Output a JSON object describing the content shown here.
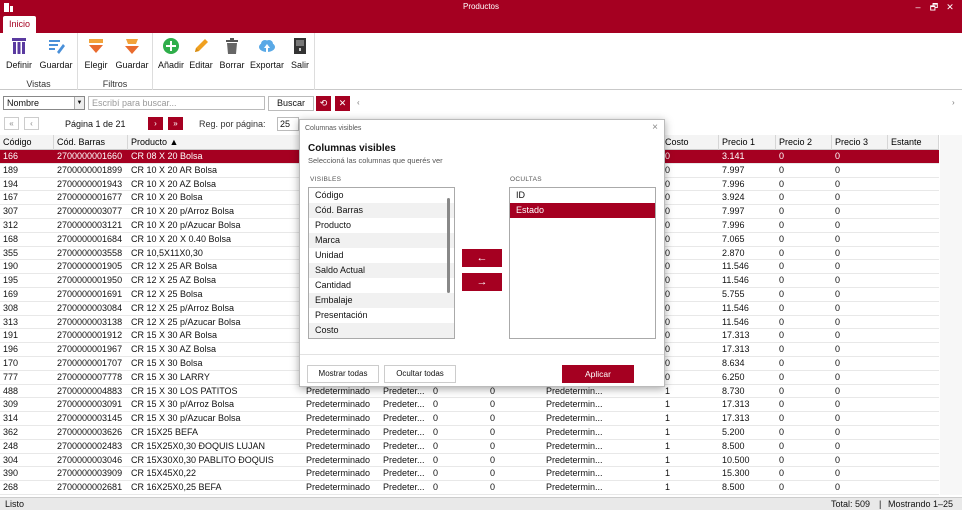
{
  "window": {
    "title": "Productos",
    "controls": {
      "minimize": "–",
      "maximize": "🗗",
      "close": "✕"
    }
  },
  "ribbon": {
    "tab": "Inicio",
    "groups": [
      {
        "label": "Vistas",
        "buttons": [
          {
            "label": "Definir",
            "icon": "columns-icon"
          },
          {
            "label": "Guardar",
            "icon": "save-view-icon"
          }
        ]
      },
      {
        "label": "Filtros",
        "buttons": [
          {
            "label": "Elegir",
            "icon": "filter-icon"
          },
          {
            "label": "Guardar",
            "icon": "save-filter-icon"
          }
        ]
      },
      {
        "label": "",
        "buttons": [
          {
            "label": "Añadir",
            "icon": "add-icon"
          },
          {
            "label": "Editar",
            "icon": "pencil-icon"
          },
          {
            "label": "Borrar",
            "icon": "trash-icon"
          },
          {
            "label": "Exportar",
            "icon": "cloud-upload-icon"
          },
          {
            "label": "Salir",
            "icon": "exit-icon"
          }
        ]
      }
    ]
  },
  "search": {
    "field": "Nombre",
    "placeholder": "Escribí para buscar...",
    "button": "Buscar"
  },
  "pager": {
    "first": "«",
    "prev": "‹",
    "page_text": "Página 1 de 21",
    "next": "›",
    "last": "»",
    "per_page_label": "Reg. por página:",
    "per_page": "25"
  },
  "grid": {
    "columns": [
      "Código",
      "Cód. Barras",
      "Producto ▲",
      "",
      "",
      "",
      "",
      "",
      "Costo",
      "Precio 1",
      "Precio 2",
      "Precio 3",
      "Estante"
    ],
    "rows": [
      {
        "c": [
          "166",
          "2700000001660",
          "CR 08 X 20 Bolsa",
          "",
          "",
          "",
          "",
          "",
          "0",
          "3.141",
          "0",
          "0",
          ""
        ],
        "sel": true
      },
      {
        "c": [
          "189",
          "2700000001899",
          "CR 10 X 20 AR Bolsa",
          "",
          "",
          "",
          "",
          "",
          "0",
          "7.997",
          "0",
          "0",
          ""
        ]
      },
      {
        "c": [
          "194",
          "2700000001943",
          "CR 10 X 20 AZ Bolsa",
          "",
          "",
          "",
          "",
          "",
          "0",
          "7.996",
          "0",
          "0",
          ""
        ]
      },
      {
        "c": [
          "167",
          "2700000001677",
          "CR 10 X 20 Bolsa",
          "",
          "",
          "",
          "",
          "",
          "0",
          "3.924",
          "0",
          "0",
          ""
        ]
      },
      {
        "c": [
          "307",
          "2700000003077",
          "CR 10 X 20 p/Arroz Bolsa",
          "",
          "",
          "",
          "",
          "",
          "0",
          "7.997",
          "0",
          "0",
          ""
        ]
      },
      {
        "c": [
          "312",
          "2700000003121",
          "CR 10 X 20 p/Azucar Bolsa",
          "",
          "",
          "",
          "",
          "",
          "0",
          "7.996",
          "0",
          "0",
          ""
        ]
      },
      {
        "c": [
          "168",
          "2700000001684",
          "CR 10 X 20 X 0.40 Bolsa",
          "",
          "",
          "",
          "",
          "",
          "0",
          "7.065",
          "0",
          "0",
          ""
        ]
      },
      {
        "c": [
          "355",
          "2700000003558",
          "CR 10,5X11X0,30",
          "",
          "",
          "",
          "",
          "",
          "0",
          "2.870",
          "0",
          "0",
          ""
        ]
      },
      {
        "c": [
          "190",
          "2700000001905",
          "CR 12 X 25 AR Bolsa",
          "",
          "",
          "",
          "",
          "",
          "0",
          "11.546",
          "0",
          "0",
          ""
        ]
      },
      {
        "c": [
          "195",
          "2700000001950",
          "CR 12 X 25 AZ Bolsa",
          "",
          "",
          "",
          "",
          "",
          "0",
          "11.546",
          "0",
          "0",
          ""
        ]
      },
      {
        "c": [
          "169",
          "2700000001691",
          "CR 12 X 25 Bolsa",
          "",
          "",
          "",
          "",
          "",
          "0",
          "5.755",
          "0",
          "0",
          ""
        ]
      },
      {
        "c": [
          "308",
          "2700000003084",
          "CR 12 X 25 p/Arroz Bolsa",
          "",
          "",
          "",
          "",
          "",
          "0",
          "11.546",
          "0",
          "0",
          ""
        ]
      },
      {
        "c": [
          "313",
          "2700000003138",
          "CR 12 X 25 p/Azucar Bolsa",
          "",
          "",
          "",
          "",
          "",
          "0",
          "11.546",
          "0",
          "0",
          ""
        ]
      },
      {
        "c": [
          "191",
          "2700000001912",
          "CR 15 X 30 AR Bolsa",
          "",
          "",
          "",
          "",
          "",
          "0",
          "17.313",
          "0",
          "0",
          ""
        ]
      },
      {
        "c": [
          "196",
          "2700000001967",
          "CR 15 X 30 AZ Bolsa",
          "",
          "",
          "",
          "",
          "",
          "0",
          "17.313",
          "0",
          "0",
          ""
        ]
      },
      {
        "c": [
          "170",
          "2700000001707",
          "CR 15 X 30 Bolsa",
          "",
          "",
          "",
          "",
          "",
          "0",
          "8.634",
          "0",
          "0",
          ""
        ]
      },
      {
        "c": [
          "777",
          "2700000007778",
          "CR 15 X 30 LARRY",
          "",
          "",
          "",
          "",
          "",
          "0",
          "6.250",
          "0",
          "0",
          ""
        ]
      },
      {
        "c": [
          "488",
          "2700000004883",
          "CR 15 X 30 LOS PATITOS",
          "Predeterminado",
          "Predeter...",
          "0",
          "0",
          "Predetermin...",
          "1",
          "8.730",
          "0",
          "0",
          ""
        ]
      },
      {
        "c": [
          "309",
          "2700000003091",
          "CR 15 X 30 p/Arroz Bolsa",
          "Predeterminado",
          "Predeter...",
          "0",
          "0",
          "Predetermin...",
          "1",
          "17.313",
          "0",
          "0",
          ""
        ]
      },
      {
        "c": [
          "314",
          "2700000003145",
          "CR 15 X 30 p/Azucar Bolsa",
          "Predeterminado",
          "Predeter...",
          "0",
          "0",
          "Predetermin...",
          "1",
          "17.313",
          "0",
          "0",
          ""
        ]
      },
      {
        "c": [
          "362",
          "2700000003626",
          "CR 15X25 BEFA",
          "Predeterminado",
          "Predeter...",
          "0",
          "0",
          "Predetermin...",
          "1",
          "5.200",
          "0",
          "0",
          ""
        ]
      },
      {
        "c": [
          "248",
          "2700000002483",
          "CR 15X25X0,30 ÐOQUIS LUJAN",
          "Predeterminado",
          "Predeter...",
          "0",
          "0",
          "Predetermin...",
          "1",
          "8.500",
          "0",
          "0",
          ""
        ]
      },
      {
        "c": [
          "304",
          "2700000003046",
          "CR 15X30X0,30 PABLITO ÐOQUIS",
          "Predeterminado",
          "Predeter...",
          "0",
          "0",
          "Predetermin...",
          "1",
          "10.500",
          "0",
          "0",
          ""
        ]
      },
      {
        "c": [
          "390",
          "2700000003909",
          "CR 15X45X0,22",
          "Predeterminado",
          "Predeter...",
          "0",
          "0",
          "Predetermin...",
          "1",
          "15.300",
          "0",
          "0",
          ""
        ]
      },
      {
        "c": [
          "268",
          "2700000002681",
          "CR 16X25X0,25 BEFA",
          "Predeterminado",
          "Predeter...",
          "0",
          "0",
          "Predetermin...",
          "1",
          "8.500",
          "0",
          "0",
          ""
        ]
      }
    ]
  },
  "status": {
    "left": "Listo",
    "total": "Total: 509",
    "sep": "|",
    "showing": "Mostrando 1–25"
  },
  "dialog": {
    "title": "Columnas visibles",
    "heading": "Columnas visibles",
    "subtitle": "Seleccioná las columnas que querés ver",
    "visible_label": "VISIBLES",
    "hidden_label": "OCULTAS",
    "visible": [
      "Código",
      "Cód. Barras",
      "Producto",
      "Marca",
      "Unidad",
      "Saldo Actual",
      "Cantidad",
      "Embalaje",
      "Presentación",
      "Costo"
    ],
    "hidden": [
      "ID",
      "Estado"
    ],
    "hidden_selected": "Estado",
    "move_left": "←",
    "move_right": "→",
    "show_all": "Mostrar todas",
    "hide_all": "Ocultar todas",
    "apply": "Aplicar",
    "close": "×"
  },
  "colors": {
    "accent": "#a50021"
  }
}
